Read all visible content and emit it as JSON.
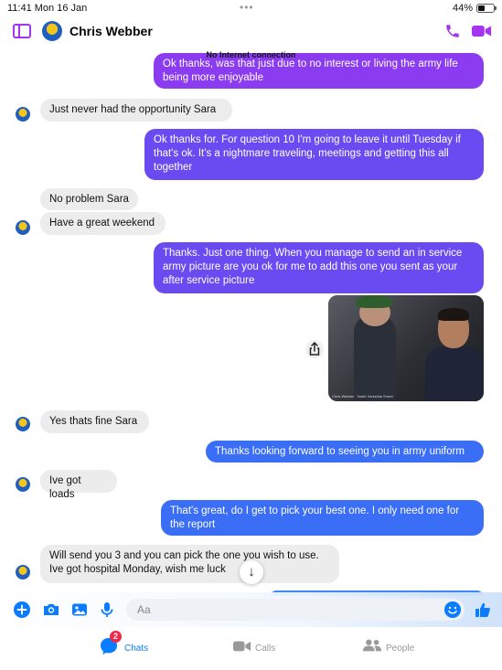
{
  "status_bar": {
    "time": "11:41  Mon 16 Jan",
    "dots": "•••",
    "battery": "44%"
  },
  "header": {
    "contact_name": "Chris Webber"
  },
  "banner": {
    "no_internet": "No Internet connection"
  },
  "messages": [
    {
      "dir": "out",
      "text": "Ok thanks, was that just due to no interest or living the army life being more enjoyable"
    },
    {
      "dir": "in",
      "text": "Just never had the opportunity Sara"
    },
    {
      "dir": "out",
      "text": "Ok thanks for. For question 10 I'm going to leave it until Tuesday if that's ok. It's a nightmare traveling, meetings and getting this all together"
    },
    {
      "dir": "in",
      "text": "No problem Sara"
    },
    {
      "dir": "in",
      "text": "Have a great weekend"
    },
    {
      "dir": "out",
      "text": "Thanks. Just one thing. When you manage to send an in service army picture are you ok for me to add this one you sent as your after service picture"
    },
    {
      "dir": "out",
      "type": "photo",
      "caption": "Chris Webber · North Yorkshire Event"
    },
    {
      "dir": "in",
      "text": "Yes thats fine Sara"
    },
    {
      "dir": "out",
      "text": "Thanks looking forward to seeing you in army uniform"
    },
    {
      "dir": "in",
      "text": "Ive got loads"
    },
    {
      "dir": "out",
      "text": "That's great, do I get to pick your best one. I only need one for the report"
    },
    {
      "dir": "in",
      "text": "Will send you 3 and you can pick the one you wish to use. Ive got hospital Monday, wish me luck"
    }
  ],
  "composer": {
    "placeholder": "Aa"
  },
  "tabs": [
    {
      "label": "Chats",
      "badge": "2",
      "icon": "chat-bubble-icon",
      "active": true
    },
    {
      "label": "Calls",
      "icon": "video-camera-icon",
      "active": false
    },
    {
      "label": "People",
      "icon": "people-icon",
      "active": false
    }
  ],
  "colors": {
    "accent": "#a633f0",
    "outgoing_purple": "#8b3cf0",
    "outgoing_blue": "#3b6ef6",
    "incoming": "#ececec",
    "tab_active": "#0a7cff",
    "badge": "#f0284a"
  }
}
